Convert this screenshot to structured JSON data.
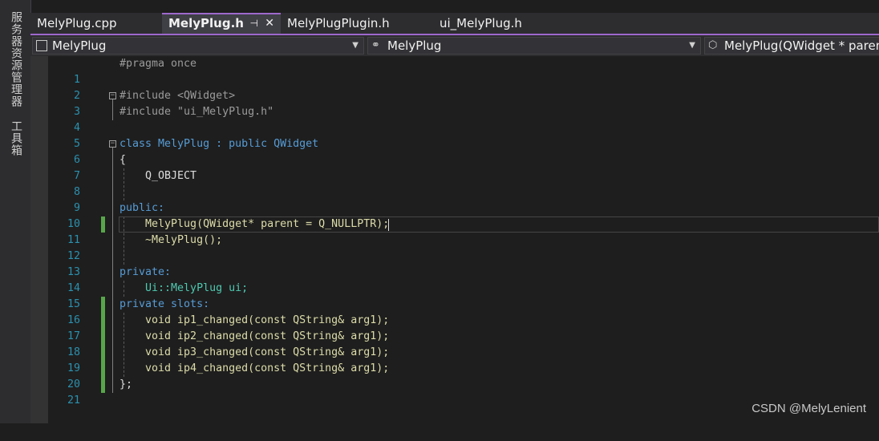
{
  "sidebar": {
    "tabs": [
      {
        "label": "服务器资源管理器"
      },
      {
        "label": "工具箱"
      }
    ]
  },
  "editor_tabs": [
    {
      "label": "MelyPlug.cpp",
      "active": false
    },
    {
      "label": "MelyPlug.h",
      "active": true,
      "pin_icon": "pin-icon",
      "close_icon": "close-icon"
    },
    {
      "label": "MelyPlugPlugin.h",
      "active": false
    },
    {
      "label": "ui_MelyPlug.h",
      "active": false
    }
  ],
  "nav": {
    "project": "MelyPlug",
    "scope": "MelyPlug",
    "member": "MelyPlug(QWidget * parent"
  },
  "lines": [
    {
      "n": "1",
      "text": "#pragma once"
    },
    {
      "n": "2",
      "text": ""
    },
    {
      "n": "3",
      "text": "#include <QWidget>"
    },
    {
      "n": "4",
      "text": "#include \"ui_MelyPlug.h\""
    },
    {
      "n": "5",
      "text": ""
    },
    {
      "n": "6",
      "text": "class MelyPlug : public QWidget"
    },
    {
      "n": "7",
      "text": "{"
    },
    {
      "n": "8",
      "text": "    Q_OBJECT"
    },
    {
      "n": "9",
      "text": ""
    },
    {
      "n": "10",
      "text": "public:"
    },
    {
      "n": "11",
      "text": "    MelyPlug(QWidget* parent = Q_NULLPTR);"
    },
    {
      "n": "12",
      "text": "    ~MelyPlug();"
    },
    {
      "n": "13",
      "text": ""
    },
    {
      "n": "14",
      "text": "private:"
    },
    {
      "n": "15",
      "text": "    Ui::MelyPlug ui;"
    },
    {
      "n": "16",
      "text": "private slots:"
    },
    {
      "n": "17",
      "text": "    void ip1_changed(const QString& arg1);"
    },
    {
      "n": "18",
      "text": "    void ip2_changed(const QString& arg1);"
    },
    {
      "n": "19",
      "text": "    void ip3_changed(const QString& arg1);"
    },
    {
      "n": "20",
      "text": "    void ip4_changed(const QString& arg1);"
    },
    {
      "n": "21",
      "text": "};"
    }
  ],
  "watermark": "CSDN @MelyLenient",
  "colors": {
    "accent": "#9e68cc",
    "line_number": "#2b91af",
    "keyword": "#569cd6",
    "type": "#4ec9b0",
    "string": "#d69d85",
    "function": "#dcdcaa",
    "macro": "#beb7ff",
    "change_bar": "#57a64a"
  }
}
